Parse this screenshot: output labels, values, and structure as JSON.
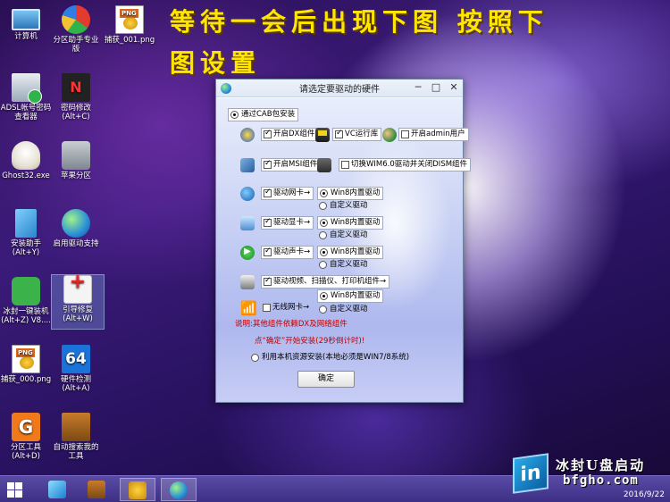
{
  "overlay_text": {
    "line1": "等待一会后出现下图 按照下",
    "line2": "图设置"
  },
  "desktop_icons": [
    {
      "label": "计算机"
    },
    {
      "label": "分区助手专业版"
    },
    {
      "label": "捕获_001.png"
    },
    {
      "label": "ADSL帐号密码查看器"
    },
    {
      "label": "密码修改(Alt+C)"
    },
    {
      "label": "Ghost32.exe"
    },
    {
      "label": "苹果分区"
    },
    {
      "label": "安装助手(Alt+Y)"
    },
    {
      "label": "启用驱动支持"
    },
    {
      "label": "冰封一键装机(Alt+Z) V8...."
    },
    {
      "label": "引导修复(Alt+W)"
    },
    {
      "label": "捕获_000.png"
    },
    {
      "label": "硬件检测(Alt+A)"
    },
    {
      "label": "分区工具(Alt+D)"
    },
    {
      "label": "自动搜索我的工具"
    }
  ],
  "icon_glyphs": {
    "key": "N",
    "hw64": "64",
    "part": "G"
  },
  "dialog": {
    "title": "请选定要驱动的硬件",
    "controls": {
      "minimize": "─",
      "maximize": "□",
      "close": "✕"
    },
    "cab_install": "通过CAB包安装",
    "dx": "开启DX组件",
    "vc": "VC运行库",
    "admin": "开启admin用户",
    "msi": "开启MSI组件",
    "switch_wim": "切换WIM6.0驱动并关闭DISM组件",
    "net_card": "驱动网卡→",
    "display_card": "驱动显卡→",
    "sound_card": "驱动声卡→",
    "video_scanner": "驱动视频、扫描仪、打印机组件→",
    "wifi_card": "无线网卡→",
    "win8_builtin": "Win8内置驱动",
    "custom_driver": "自定义驱动",
    "note1": "说明:其他组件依赖DX及网络组件",
    "note2": "点“确定”开始安装(29秒倒计时)!",
    "local_install": "利用本机资源安装(本地必须是WIN7/8系统)",
    "ok": "确定"
  },
  "brand": {
    "logo": "in",
    "name": "冰封U盘启动",
    "site": "bfgho.com",
    "date": "2016/9/22"
  }
}
